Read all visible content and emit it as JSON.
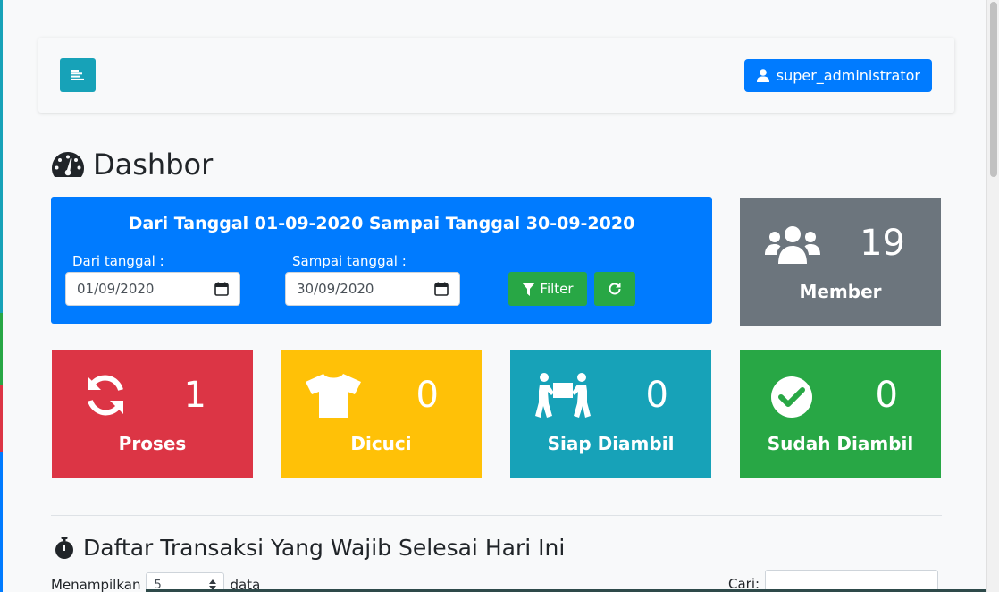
{
  "header": {
    "user_label": "super_administrator"
  },
  "page": {
    "title": "Dashbor"
  },
  "filter": {
    "heading": "Dari Tanggal 01-09-2020 Sampai Tanggal 30-09-2020",
    "from_label": "Dari tanggal :",
    "from_value": "01/09/2020",
    "to_label": "Sampai tanggal :",
    "to_value": "30/09/2020",
    "filter_button": "Filter"
  },
  "stats": {
    "member": {
      "value": "19",
      "label": "Member",
      "color": "#6c757d",
      "icon": "users-icon"
    },
    "proses": {
      "value": "1",
      "label": "Proses",
      "color": "#dc3545",
      "icon": "sync-icon"
    },
    "dicuci": {
      "value": "0",
      "label": "Dicuci",
      "color": "#ffc107",
      "icon": "tshirt-icon"
    },
    "siap_diambil": {
      "value": "0",
      "label": "Siap Diambil",
      "color": "#17a2b8",
      "icon": "people-carry-icon"
    },
    "sudah_diambil": {
      "value": "0",
      "label": "Sudah Diambil",
      "color": "#28a745",
      "icon": "check-circle-icon"
    }
  },
  "transactions": {
    "title": "Daftar Transaksi Yang Wajib Selesai Hari Ini",
    "show_prefix": "Menampilkan",
    "show_value": "5",
    "show_suffix": "data",
    "search_label": "Cari:"
  },
  "colors": {
    "primary": "#007bff",
    "info": "#17a2b8",
    "success": "#28a745",
    "danger": "#dc3545",
    "warning": "#ffc107",
    "secondary": "#6c757d"
  }
}
